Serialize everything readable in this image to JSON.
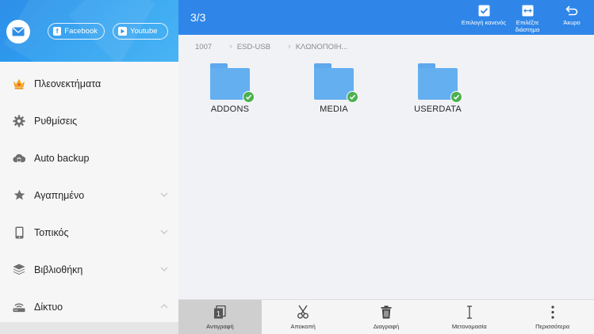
{
  "sidebar": {
    "social": {
      "facebook": "Facebook",
      "youtube": "Youtube"
    },
    "items": [
      {
        "label": "Πλεονεκτήματα",
        "icon": "crown-icon",
        "chevron": ""
      },
      {
        "label": "Ρυθμίσεις",
        "icon": "gear-icon",
        "chevron": ""
      },
      {
        "label": "Auto backup",
        "icon": "cloud-sync-icon",
        "chevron": ""
      },
      {
        "label": "Αγαπημένο",
        "icon": "star-icon",
        "chevron": "down"
      },
      {
        "label": "Τοπικός",
        "icon": "phone-icon",
        "chevron": "down"
      },
      {
        "label": "Βιβλιοθήκη",
        "icon": "layers-icon",
        "chevron": "down"
      },
      {
        "label": "Δίκτυο",
        "icon": "router-icon",
        "chevron": "up"
      }
    ]
  },
  "topbar": {
    "count": "3/3",
    "select_none": "Επιλογή κανενός",
    "select_range": "Επιλέξτε διάστημα",
    "cancel": "Άκυρο"
  },
  "breadcrumb": [
    "1007",
    "ESD-USB",
    "ΚΛΩΝΟΠΟΙΗ..."
  ],
  "files": [
    {
      "name": "ADDONS"
    },
    {
      "name": "MEDIA"
    },
    {
      "name": "USERDATA"
    }
  ],
  "bottombar": {
    "copy": "Αντιγραφή",
    "copy_badge": "1",
    "cut": "Αποκοπή",
    "delete": "Διαγραφή",
    "rename": "Μετονομασία",
    "more": "Περισσότερα"
  },
  "colors": {
    "accent": "#2f86e8",
    "folder": "#64aff0",
    "check": "#4cb04f",
    "crown": "#f5a623"
  }
}
